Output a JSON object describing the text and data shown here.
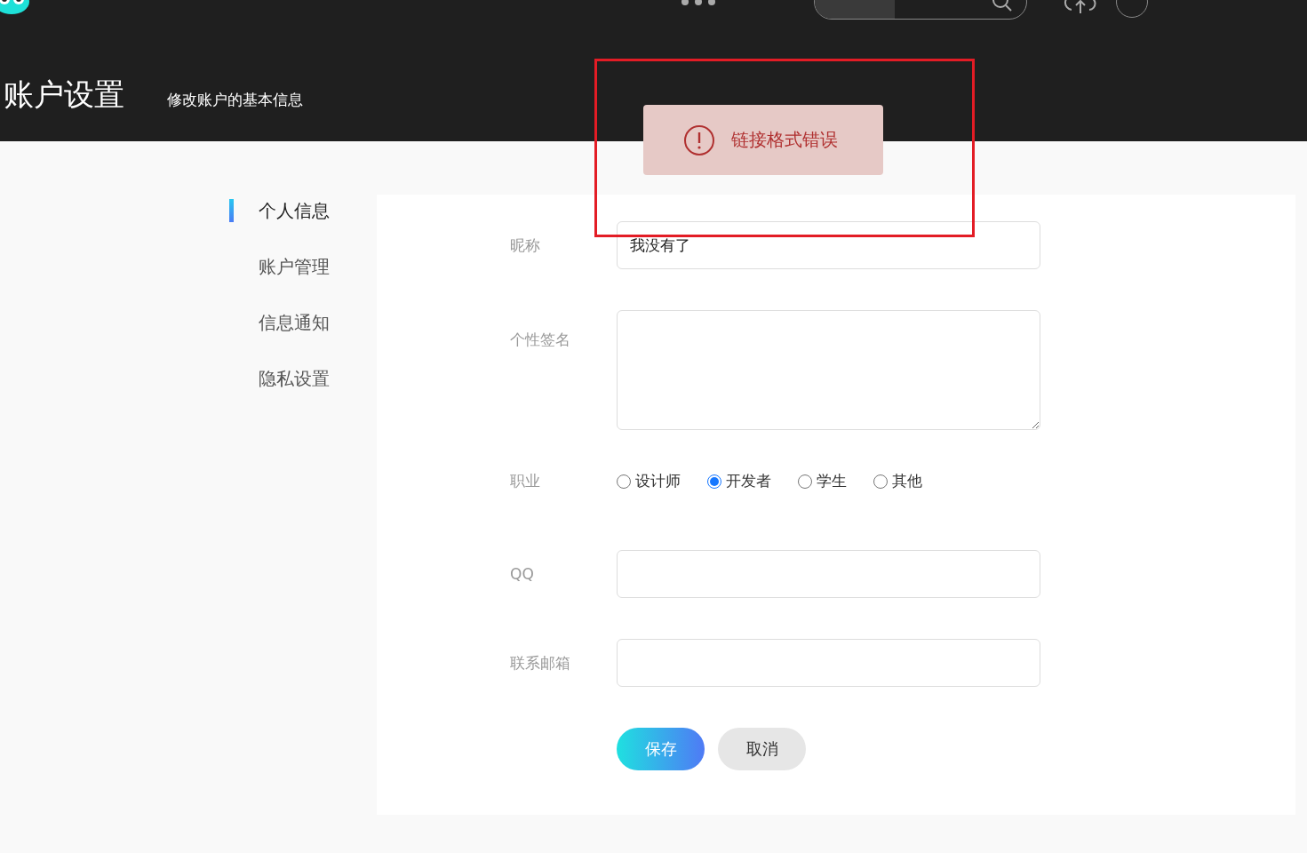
{
  "header": {
    "title": "账户设置",
    "subtitle": "修改账户的基本信息"
  },
  "toast": {
    "kind": "error",
    "message": "链接格式错误"
  },
  "sidebar": {
    "items": [
      {
        "label": "个人信息",
        "selected": true
      },
      {
        "label": "账户管理",
        "selected": false
      },
      {
        "label": "信息通知",
        "selected": false
      },
      {
        "label": "隐私设置",
        "selected": false
      }
    ]
  },
  "form": {
    "fields": [
      {
        "kind": "input",
        "label": "昵称",
        "value": "我没有了"
      },
      {
        "kind": "textarea",
        "label": "个性签名"
      },
      {
        "kind": "radio",
        "label": "职业",
        "options": [
          {
            "label": "设计师",
            "selected": false
          },
          {
            "label": "开发者",
            "selected": true
          },
          {
            "label": "学生",
            "selected": false
          },
          {
            "label": "其他",
            "selected": false
          }
        ]
      },
      {
        "kind": "input",
        "label": "QQ"
      },
      {
        "kind": "input",
        "label": "联系邮箱"
      }
    ],
    "buttons": [
      {
        "kind": "primary",
        "label": "保存"
      },
      {
        "kind": "secondary",
        "label": "取消"
      }
    ]
  }
}
